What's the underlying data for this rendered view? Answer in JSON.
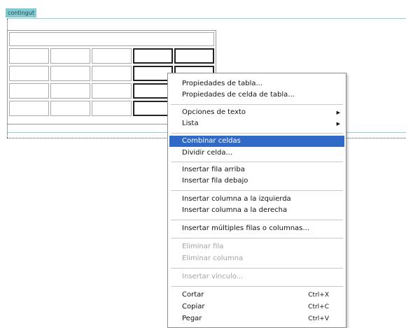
{
  "editor": {
    "content_tag": "contingut"
  },
  "table": {
    "rows": 4,
    "cols": 5
  },
  "context_menu": {
    "items": [
      {
        "label": "Propiedades de tabla...",
        "enabled": true
      },
      {
        "label": "Propiedades de celda de tabla...",
        "enabled": true
      },
      {
        "label": "Opciones de texto",
        "enabled": true,
        "submenu": true
      },
      {
        "label": "Lista",
        "enabled": true,
        "submenu": true
      },
      {
        "label": "Combinar celdas",
        "enabled": true,
        "highlighted": true
      },
      {
        "label": "Dividir celda...",
        "enabled": true
      },
      {
        "label": "Insertar fila arriba",
        "enabled": true
      },
      {
        "label": "Insertar fila debajo",
        "enabled": true
      },
      {
        "label": "Insertar columna a la izquierda",
        "enabled": true
      },
      {
        "label": "Insertar columna a la derecha",
        "enabled": true
      },
      {
        "label": "Insertar múltiples filas o columnas...",
        "enabled": true
      },
      {
        "label": "Eliminar fila",
        "enabled": false
      },
      {
        "label": "Eliminar columna",
        "enabled": false
      },
      {
        "label": "Insertar vínculo...",
        "enabled": false
      },
      {
        "label": "Cortar",
        "shortcut": "Ctrl+X",
        "enabled": true
      },
      {
        "label": "Copiar",
        "shortcut": "Ctrl+C",
        "enabled": true
      },
      {
        "label": "Pegar",
        "shortcut": "Ctrl+V",
        "enabled": true
      }
    ],
    "submenu_arrow": "▶"
  },
  "colors": {
    "highlight": "#3169c6",
    "content_tag_bg": "#7fcbd0",
    "region_line": "#8fd3d6"
  }
}
